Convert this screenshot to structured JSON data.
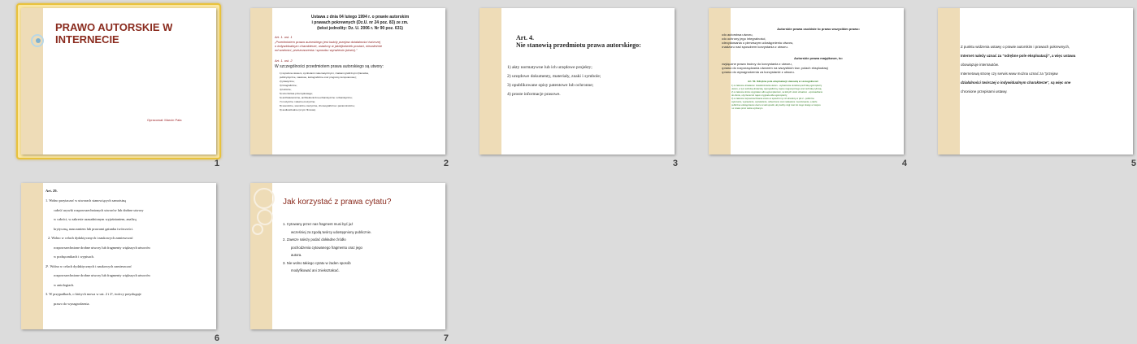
{
  "slides": [
    {
      "number": "1",
      "title_lines": [
        "PRAWO AUTORSKIE W",
        "INTERNECIE"
      ],
      "author": "Opracował: Marcin Pala"
    },
    {
      "number": "2",
      "heading": [
        "Ustawa z dnia 04 lutego 1994 r. o prawie autorskim",
        "i prawach pokrewnych (Dz.U. nr 24 poz. 83) ze zm.",
        "(tekst jednolity: Dz. U. 2006 r. Nr 90 poz. 631)"
      ],
      "art1_label": "Art. 1. ust. 1",
      "art1_text": [
        "„Przedmiotem prawa autorskiego jest każdy przejaw działalności twórczej",
        "o indywidualnym charakterze, ustalony w jakiejkolwiek postaci, niezależnie",
        "od wartości, przeznaczenia i sposobu wyrażenia (utwór).”"
      ],
      "art2_label": "Art. 1. ust. 2",
      "art2_intro": "W szczególności przedmiotem prawa autorskiego są utwory:",
      "list": [
        "1) wyrażone słowem, symbolami matematycznymi, znakami graficznymi (literackie,",
        "publicystyczne, naukowe, kartograficzne oraz programy komputerowe);",
        "2) plastyczne;",
        "3) fotograficzne;",
        "4) lutnicze;",
        "5) wzornictwa przemysłowego;",
        "6) architektoniczne, architektoniczno-urbanistyczne i urbanistyczne;",
        "7) muzyczne i słowno-muzyczne;",
        "8) sceniczne, sceniczno-muzyczne, choreograficzne i pantomimiczne;",
        "9) audiowizualne (w tym filmowe)."
      ]
    },
    {
      "number": "3",
      "art_label": "Art. 4.",
      "heading": "Nie stanowią przedmiotu prawa autorskiego:",
      "items": [
        "1) akty normatywne lub ich urzędowe projekty;",
        "2) urzędowe dokumenty, materiały, znaki i symbole;",
        "3) opublikowane opisy patentowe lub ochronne;",
        "4) proste informacje prasowe."
      ]
    },
    {
      "number": "4",
      "personal_heading": "Autorskie prawa osobiste to prawo wszystkim prawo:",
      "personal_items": [
        "•do autorstwa utworu,",
        "•do ochrony jego integralności,",
        "•decydowania o pierwszym udostępnieniu utworu,",
        "•nadzoru nad sposobem korzystania z utworu."
      ],
      "property_heading": "Autorskie prawa majątkowe, to:",
      "property_items": [
        "•wyłączne prawo twórcy do korzystania z utworu,",
        "•prawo do rozporządzania utworem na wszystkich tzw. polach eksploatacji",
        "•prawo do wynagrodzenia za korzystanie z utworu."
      ],
      "art50_label": "Art. 50. Odrębne pola eksploatacji stanowią w szczególności:",
      "art50_items": [
        "1) w zakresie utrwalania i zwielokrotniania utworu - wytwarzanie określoną techniką egzemplarzy",
        "utworu, w tym techniką drukarską, reprograficzną, zapisu magnetycznego oraz techniką cyfrową;",
        "2) w zakresie obrotu oryginałem albo egzemplarzami, na których utwór utrwalono - wprowadzanie",
        "do obrotu, użyczenie lub najem oryginału albo egzemplarzy;",
        "3) w zakresie rozpowszechniania utworu w sposób inny niż określony w pkt 2 - publiczne",
        "wykonanie, wystawienie, wyświetlenie, odtworzenie oraz nadawanie i reemitowanie, a także",
        "publiczne udostępnianie utworu w taki sposób, aby każdy mógł mieć do niego dostęp w miejscu",
        "i w czasie przez siebie wybranym."
      ]
    },
    {
      "number": "5",
      "lines": [
        "Z punktu widzenia ustawy o prawie autorskim i prawach pokrewnych,",
        "Internet należy uznać za \"odrębne pole eksploatacji\", a więc ustawa",
        "obowiązuje internautów.",
        "Internetową stronę czy serwis www można uznać za \"przejaw",
        "działalności twórczej o indywidualnym charakterze\", są więc one",
        "chronione przepisami ustawy."
      ]
    },
    {
      "number": "6",
      "art_label": "Art. 29.",
      "lines": [
        "1. Wolno przytaczać w utworach stanowiących samoistną",
        "całość urywki rozpowszechnionych utworów lub drobne utwory",
        "w całości, w zakresie uzasadnionym wyjaśnianiem, analizą",
        "krytyczną, nauczaniem lub prawami gatunku twórczości.",
        "2. Wolno w celach dydaktycznych i naukowych zamieszczać",
        "rozpowszechnione drobne utwory lub fragmenty większych utworów",
        "w podręcznikach i wypisach.",
        "2¹. Wolno w celach dydaktycznych i naukowych zamieszczać",
        "rozpowszechnione drobne utwory lub fragmenty większych utworów",
        "w antologiach.",
        "3. W przypadkach, o których mowa w ust. 2 i 2¹, twórcy przysługuje",
        "prawo do wynagrodzenia."
      ]
    },
    {
      "number": "7",
      "title": "Jak korzystać z prawa cytatu?",
      "items": [
        "1.   Cytowany przez nas fragment musi być już",
        "wcześniej za zgodą twórcy udostępniony publicznie.",
        "2.   Zawsze należy podać dokładne źródło",
        "pochodzenia cytowanego fragmentu oraz jego",
        "autora.",
        "3.   Nie wolno takiego cytatu w żaden sposób",
        "modyfikować ani zniekształcać."
      ]
    }
  ]
}
